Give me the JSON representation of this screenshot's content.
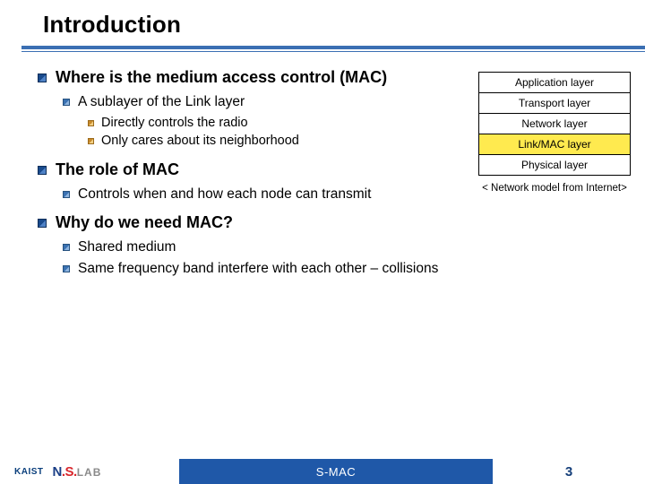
{
  "slide": {
    "title": "Introduction",
    "footer_center": "S-MAC",
    "page_number": "3",
    "logo_kaist": "KAIST",
    "logo_ns": "N.S.",
    "logo_lab": "LAB"
  },
  "content": {
    "s1": {
      "h": "Where is the medium access control (MAC)",
      "a": {
        "h": "A sublayer of the Link layer",
        "i": "Directly controls the radio",
        "ii": "Only cares about its neighborhood"
      }
    },
    "s2": {
      "h": "The role of MAC",
      "a": {
        "h": "Controls when and how each node can transmit"
      }
    },
    "s3": {
      "h": "Why do we need MAC?",
      "a": {
        "h": "Shared medium"
      },
      "b": {
        "h": "Same frequency band interfere with each other – collisions"
      }
    }
  },
  "layers": {
    "rows": {
      "r0": "Application layer",
      "r1": "Transport layer",
      "r2": "Network layer",
      "r3": "Link/MAC layer",
      "r4": "Physical layer"
    },
    "caption": "< Network model from Internet>"
  }
}
